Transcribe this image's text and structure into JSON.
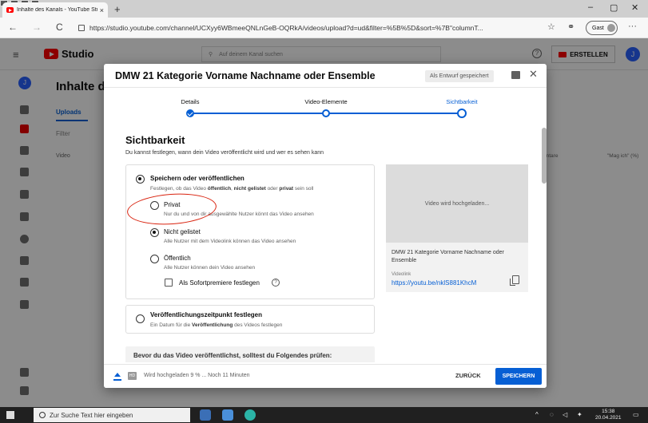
{
  "browser": {
    "tab_title": "Inhalte des Kanals - YouTube Stu",
    "tab_close": "×",
    "new_tab": "+",
    "url": "https://studio.youtube.com/channel/UCXyy6WBmeeQNLnGeB-OQRkA/videos/upload?d=ud&filter=%5B%5D&sort=%7B\"columnT...",
    "profile": "Gast",
    "win_min": "–",
    "win_max": "▢",
    "win_close": "✕",
    "back": "←",
    "forward": "→",
    "reload": "C",
    "more": "···"
  },
  "studio": {
    "logo": "Studio",
    "search_placeholder": "Auf deinem Kanal suchen",
    "create_label": "ERSTELLEN",
    "avatar_letter": "J",
    "page_title": "Inhalte de",
    "tab_uploads": "Uploads",
    "filter_label": "Filter",
    "col_video": "Video",
    "col_r1": "entare",
    "col_r2": "\"Mag ich\" (%)"
  },
  "dialog": {
    "title": "DMW 21 Kategorie Vorname Nachname oder Ensemble",
    "draft_badge": "Als Entwurf gespeichert",
    "close": "✕",
    "steps": [
      {
        "label": "Details",
        "state": "done"
      },
      {
        "label": "Video-Elemente",
        "state": "visited"
      },
      {
        "label": "Sichtbarkeit",
        "state": "current"
      }
    ],
    "section_title": "Sichtbarkeit",
    "section_desc": "Du kannst festlegen, wann dein Video veröffentlicht wird und wer es sehen kann",
    "save_publish": {
      "label": "Speichern oder veröffentlichen",
      "desc_prefix": "Festlegen, ob das Video ",
      "desc_b1": "öffentlich",
      "desc_mid1": ", ",
      "desc_b2": "nicht gelistet",
      "desc_mid2": " oder ",
      "desc_b3": "privat",
      "desc_suffix": " sein soll"
    },
    "options": [
      {
        "label": "Privat",
        "desc": "Nur du und von dir ausgewählte Nutzer könnt das Video ansehen",
        "selected": false
      },
      {
        "label": "Nicht gelistet",
        "desc": "Alle Nutzer mit dem Videolink können das Video ansehen",
        "selected": true
      },
      {
        "label": "Öffentlich",
        "desc": "Alle Nutzer können dein Video ansehen",
        "selected": false
      }
    ],
    "premiere_label": "Als Sofortpremiere festlegen",
    "schedule": {
      "label": "Veröffentlichungszeitpunkt festlegen",
      "desc_prefix": "Ein Datum für die ",
      "desc_b": "Veröffentlichung",
      "desc_suffix": " des Videos festlegen"
    },
    "check_title": "Bevor du das Video veröffentlichst, solltest du Folgendes prüfen:",
    "preview": {
      "thumb_text": "Video wird hochgeladen...",
      "video_title": "DMW 21 Kategorie Vorname Nachname oder Ensemble",
      "link_label": "Videolink",
      "link": "https://youtu.be/nklS881KhcM"
    },
    "footer": {
      "status": "Wird hochgeladen 9 % ... Noch 11 Minuten",
      "upload_percent": 9,
      "hd_badge": "HD",
      "back": "ZURÜCK",
      "save": "SPEICHERN"
    }
  },
  "taskbar": {
    "search_placeholder": "Zur Suche Text hier eingeben",
    "time": "15:38",
    "date": "20.04.2021"
  },
  "colors": {
    "accent": "#065fd4",
    "youtube_red": "#ff0000",
    "annotation_circle": "#d9230f"
  }
}
